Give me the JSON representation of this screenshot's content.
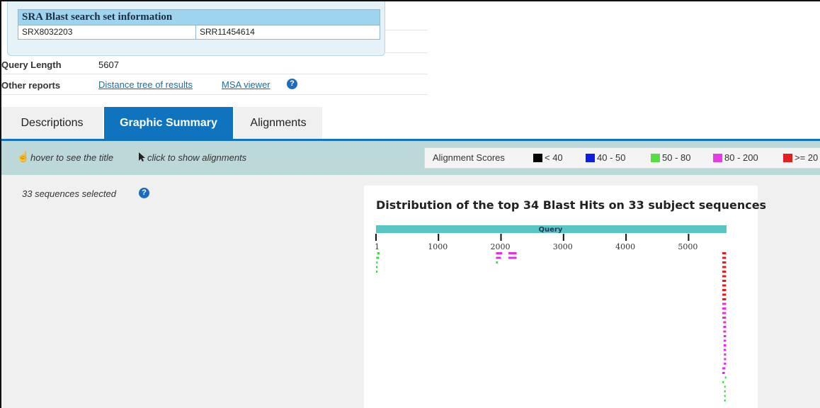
{
  "info_box": {
    "title": "SRA Blast search set information",
    "experiment": "SRX8032203",
    "run": "SRR11454614"
  },
  "query_length": {
    "label": "Query Length",
    "value": "5607"
  },
  "other_reports": {
    "label": "Other reports",
    "links": [
      "Distance tree of results",
      "MSA viewer"
    ]
  },
  "tabs": [
    {
      "label": "Descriptions",
      "active": false
    },
    {
      "label": "Graphic Summary",
      "active": true
    },
    {
      "label": "Alignments",
      "active": false
    }
  ],
  "toolbar": {
    "hover_hint": "hover to see the title",
    "click_hint": "click to show alignments"
  },
  "legend": {
    "title": "Alignment Scores",
    "items": [
      {
        "label": "< 40",
        "color": "#000000"
      },
      {
        "label": "40 - 50",
        "color": "#0a1ee6"
      },
      {
        "label": "50 - 80",
        "color": "#55dd44"
      },
      {
        "label": "80 - 200",
        "color": "#e63ce6"
      },
      {
        "label": ">= 20",
        "color": "#e11f1f"
      }
    ]
  },
  "selection": {
    "text": "33 sequences selected"
  },
  "graphic": {
    "title": "Distribution of the top 34 Blast Hits on 33 subject sequences",
    "query_label": "Query",
    "query_length": 5607,
    "ticks": [
      "1",
      "1000",
      "2000",
      "3000",
      "4000",
      "5000"
    ],
    "colors": {
      "query_bar": "#5ac6c4",
      "green": "#39dd39",
      "magenta": "#e32ee3",
      "red": "#e31b1b"
    },
    "hits": [
      {
        "row": 0,
        "start": 5540,
        "end": 5600,
        "score": "red"
      },
      {
        "row": 1,
        "start": 5540,
        "end": 5600,
        "score": "red"
      },
      {
        "row": 2,
        "start": 5540,
        "end": 5600,
        "score": "red"
      },
      {
        "row": 3,
        "start": 5540,
        "end": 5600,
        "score": "red"
      },
      {
        "row": 4,
        "start": 5540,
        "end": 5600,
        "score": "red"
      },
      {
        "row": 5,
        "start": 5540,
        "end": 5600,
        "score": "red"
      },
      {
        "row": 6,
        "start": 5540,
        "end": 5600,
        "score": "red"
      },
      {
        "row": 7,
        "start": 5540,
        "end": 5600,
        "score": "red"
      },
      {
        "row": 8,
        "start": 5540,
        "end": 5600,
        "score": "red"
      },
      {
        "row": 9,
        "start": 5540,
        "end": 5600,
        "score": "red"
      },
      {
        "row": 10,
        "start": 5540,
        "end": 5600,
        "score": "red"
      },
      {
        "row": 11,
        "start": 5540,
        "end": 5600,
        "score": "magenta"
      },
      {
        "row": 12,
        "start": 5540,
        "end": 5600,
        "score": "magenta"
      },
      {
        "row": 13,
        "start": 5540,
        "end": 5600,
        "score": "magenta"
      },
      {
        "row": 14,
        "start": 5540,
        "end": 5600,
        "score": "magenta"
      },
      {
        "row": 15,
        "start": 5555,
        "end": 5600,
        "score": "magenta"
      },
      {
        "row": 16,
        "start": 5555,
        "end": 5600,
        "score": "magenta"
      },
      {
        "row": 17,
        "start": 5555,
        "end": 5600,
        "score": "magenta"
      },
      {
        "row": 18,
        "start": 5560,
        "end": 5600,
        "score": "magenta"
      },
      {
        "row": 19,
        "start": 5560,
        "end": 5600,
        "score": "magenta"
      },
      {
        "row": 20,
        "start": 5560,
        "end": 5600,
        "score": "magenta"
      },
      {
        "row": 21,
        "start": 5560,
        "end": 5600,
        "score": "magenta"
      },
      {
        "row": 22,
        "start": 5565,
        "end": 5600,
        "score": "magenta"
      },
      {
        "row": 23,
        "start": 5565,
        "end": 5600,
        "score": "magenta"
      },
      {
        "row": 24,
        "start": 5565,
        "end": 5600,
        "score": "magenta"
      },
      {
        "row": 25,
        "start": 5540,
        "end": 5590,
        "score": "magenta"
      },
      {
        "row": 26,
        "start": 5540,
        "end": 5580,
        "score": "magenta"
      },
      {
        "row": 27,
        "start": 5580,
        "end": 5600,
        "score": "green"
      },
      {
        "row": 28,
        "start": 5540,
        "end": 5565,
        "score": "green"
      },
      {
        "row": 29,
        "start": 5570,
        "end": 5585,
        "score": "green"
      },
      {
        "row": 30,
        "start": 5570,
        "end": 5578,
        "score": "green"
      },
      {
        "row": 31,
        "start": 5570,
        "end": 5578,
        "score": "green"
      },
      {
        "row": 32,
        "start": 5570,
        "end": 5578,
        "score": "green"
      },
      {
        "row": 0,
        "start": 1920,
        "end": 2020,
        "score": "magenta"
      },
      {
        "row": 0,
        "start": 2120,
        "end": 2250,
        "score": "magenta"
      },
      {
        "row": 1,
        "start": 1920,
        "end": 2000,
        "score": "magenta"
      },
      {
        "row": 1,
        "start": 2120,
        "end": 2250,
        "score": "magenta"
      },
      {
        "row": 2,
        "start": 1920,
        "end": 1950,
        "score": "green"
      },
      {
        "row": 0,
        "start": 20,
        "end": 60,
        "score": "green"
      },
      {
        "row": 1,
        "start": 5,
        "end": 50,
        "score": "green"
      },
      {
        "row": 2,
        "start": 5,
        "end": 20,
        "score": "green"
      },
      {
        "row": 3,
        "start": 1,
        "end": 12,
        "score": "green"
      },
      {
        "row": 4,
        "start": 1,
        "end": 8,
        "score": "green"
      }
    ]
  }
}
